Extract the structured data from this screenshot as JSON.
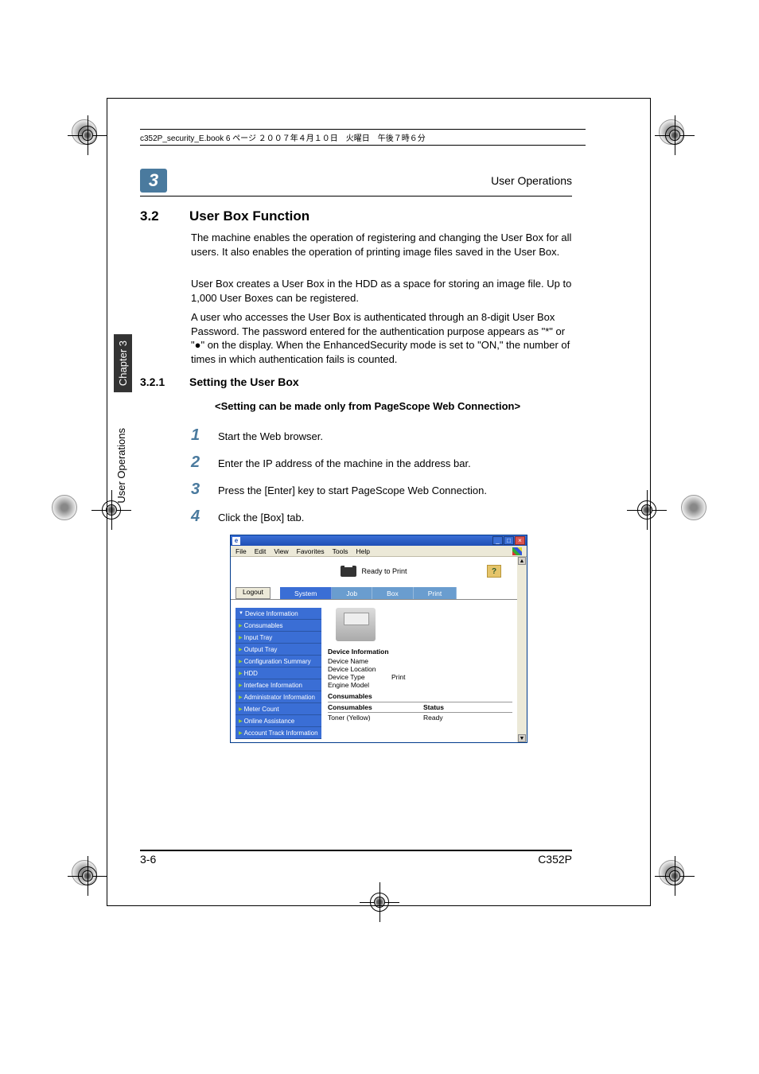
{
  "running_header": "c352P_security_E.book  6 ページ  ２００７年４月１０日　火曜日　午後７時６分",
  "chapter_badge": "3",
  "header_title": "User Operations",
  "section": {
    "num": "3.2",
    "title": "User Box Function"
  },
  "para1": "The machine enables the operation of registering and changing the User Box for all users. It also enables the operation of printing image files saved in the User Box.",
  "para2": "User Box creates a User Box in the HDD as a space for storing an image file. Up to 1,000 User Boxes can be registered.",
  "para3": "A user who accesses the User Box is authenticated through an 8-digit User Box Password. The password entered for the authentication purpose appears as \"*\" or \"●\" on the display. When the EnhancedSecurity mode is set to \"ON,\" the number of times in which authentication fails is counted.",
  "subsection": {
    "num": "3.2.1",
    "title": "Setting the User Box"
  },
  "note": "<Setting can be made only from PageScope Web Connection>",
  "steps": [
    {
      "n": "1",
      "t": "Start the Web browser."
    },
    {
      "n": "2",
      "t": "Enter the IP address of the machine in the address bar."
    },
    {
      "n": "3",
      "t": "Press the [Enter] key to start PageScope Web Connection."
    },
    {
      "n": "4",
      "t": "Click the [Box] tab."
    }
  ],
  "vtab_chapter": "Chapter 3",
  "vtab_title": "User Operations",
  "footer": {
    "left": "3-6",
    "right": "C352P"
  },
  "browser": {
    "menus": [
      "File",
      "Edit",
      "View",
      "Favorites",
      "Tools",
      "Help"
    ],
    "status_text": "Ready to Print",
    "help_label": "?",
    "logout": "Logout",
    "tabs": [
      "System",
      "Job",
      "Box",
      "Print"
    ],
    "sidebar": [
      {
        "label": "Device Information",
        "cls": "expanded"
      },
      {
        "label": "Consumables",
        "cls": "collapsed"
      },
      {
        "label": "Input Tray",
        "cls": "collapsed"
      },
      {
        "label": "Output Tray",
        "cls": "collapsed"
      },
      {
        "label": "Configuration Summary",
        "cls": "collapsed"
      },
      {
        "label": "HDD",
        "cls": "collapsed"
      },
      {
        "label": "Interface Information",
        "cls": "collapsed"
      },
      {
        "label": "Administrator Information",
        "cls": "collapsed"
      },
      {
        "label": "Meter Count",
        "cls": "collapsed"
      },
      {
        "label": "Online Assistance",
        "cls": "collapsed"
      },
      {
        "label": "Account Track Information",
        "cls": "collapsed"
      }
    ],
    "device_section": "Device Information",
    "device_rows": [
      {
        "k": "Device Name",
        "v": ""
      },
      {
        "k": "Device Location",
        "v": ""
      },
      {
        "k": "Device Type",
        "v": "Print"
      },
      {
        "k": "Engine Model",
        "v": ""
      }
    ],
    "consumables_section": "Consumables",
    "consumables_header": {
      "c1": "Consumables",
      "c2": "Status"
    },
    "consumables_rows": [
      {
        "c1": "Toner (Yellow)",
        "c2": "Ready"
      }
    ]
  }
}
